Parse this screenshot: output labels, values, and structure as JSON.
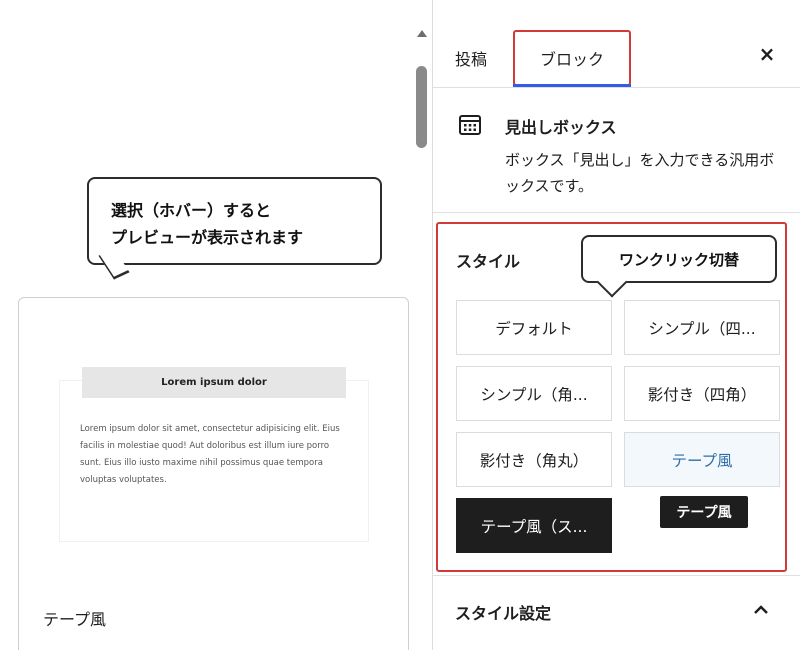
{
  "preview": {
    "heading": "Lorem ipsum dolor",
    "body": "Lorem ipsum dolor sit amet, consectetur adipisicing elit. Eius facilis in molestiae quod! Aut doloribus est illum iure porro sunt. Eius illo iusto maxime nihil possimus quae tempora voluptas voluptates.",
    "style_label": "テープ風"
  },
  "callouts": {
    "preview_line1": "選択（ホバー）すると",
    "preview_line2": "プレビューが表示されます",
    "one_click": "ワンクリック切替"
  },
  "sidebar": {
    "tabs": [
      {
        "label": "投稿"
      },
      {
        "label": "ブロック"
      }
    ],
    "close_label": "×",
    "block": {
      "icon": "block-grid-icon",
      "title": "見出しボックス",
      "description": "ボックス「見出し」を入力できる汎用ボックスです。"
    },
    "styles": {
      "heading": "スタイル",
      "options": [
        {
          "label": "デフォルト"
        },
        {
          "label": "シンプル（四..."
        },
        {
          "label": "シンプル（角..."
        },
        {
          "label": "影付き（四角）"
        },
        {
          "label": "影付き（角丸）"
        },
        {
          "label": "テープ風"
        },
        {
          "label": "テープ風（ス..."
        }
      ],
      "tooltip": "テープ風"
    },
    "style_settings": "スタイル設定"
  },
  "colors": {
    "accent": "#3858e9",
    "highlight_border": "#d23a3a",
    "selected_bg": "#1e1e1e",
    "hover_text": "#2f6ea8"
  }
}
